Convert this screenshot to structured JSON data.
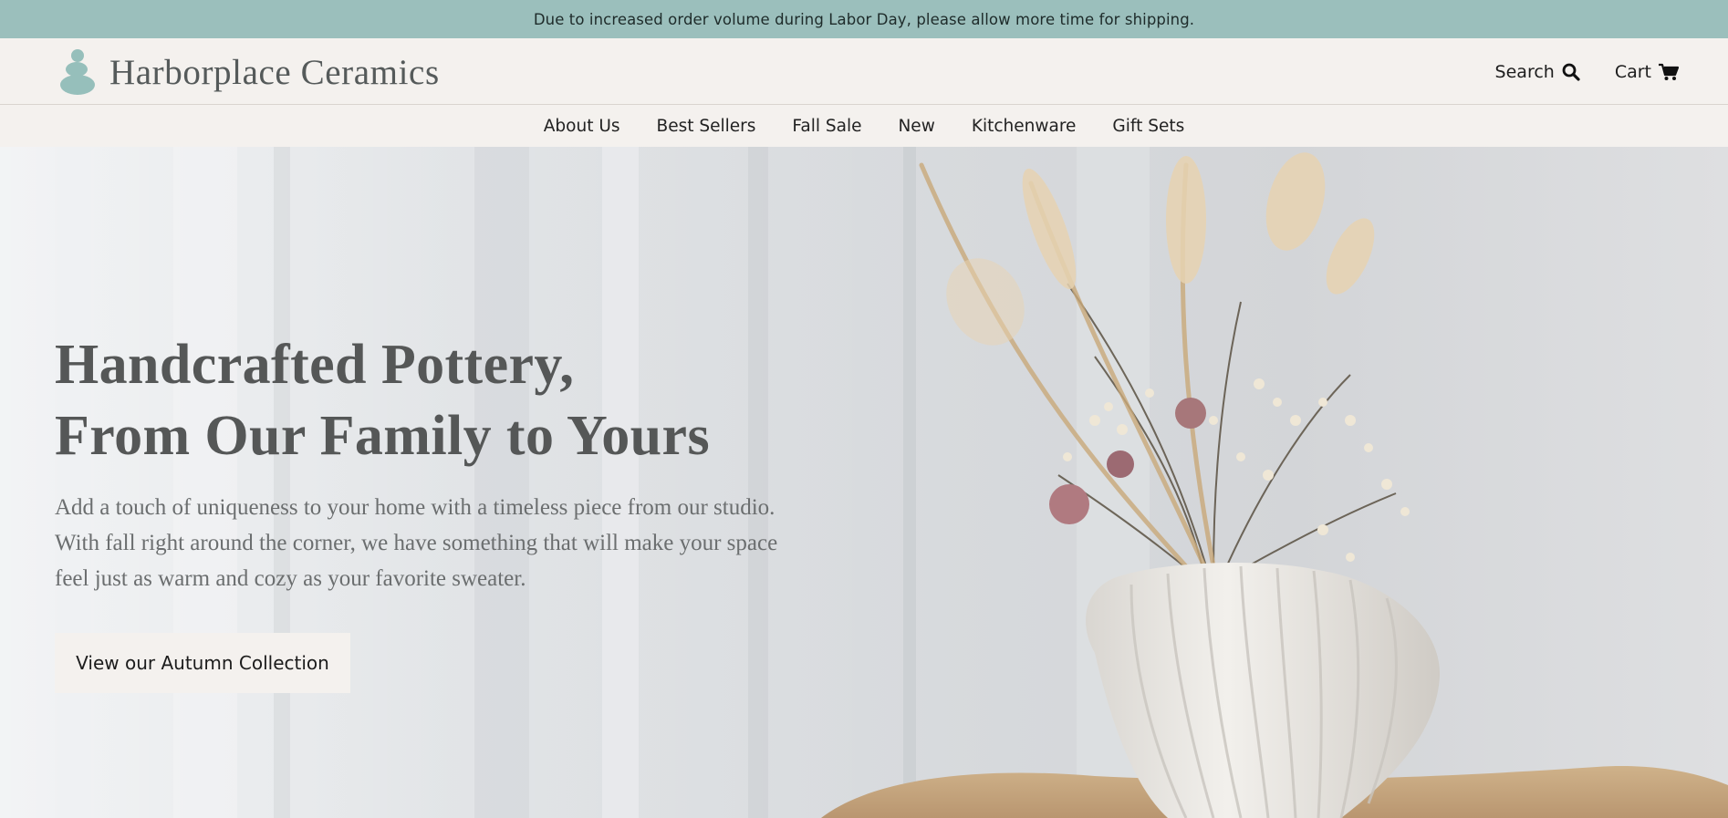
{
  "announcement": "Due to increased order volume during Labor Day, please allow more time for shipping.",
  "brand": {
    "name": "Harborplace Ceramics",
    "logo_icon": "stacked-stones-icon"
  },
  "header": {
    "search_label": "Search",
    "search_icon": "search-icon",
    "cart_label": "Cart",
    "cart_icon": "cart-icon"
  },
  "nav": {
    "items": [
      {
        "label": "About Us"
      },
      {
        "label": "Best Sellers"
      },
      {
        "label": "Fall Sale"
      },
      {
        "label": "New"
      },
      {
        "label": "Kitchenware"
      },
      {
        "label": "Gift Sets"
      }
    ]
  },
  "hero": {
    "title_line1": "Handcrafted Pottery,",
    "title_line2": "From Our Family to Yours",
    "body": "Add a touch of uniqueness to your home with a timeless piece from our studio. With fall right around the corner, we have something that will make your space feel just as warm and cozy as your favorite sweater.",
    "cta_label": "View our Autumn Collection",
    "image_subject": "white shell vase with dried flowers"
  },
  "colors": {
    "announcement_bg": "#9bbfbc",
    "header_bg": "#f4f1ee",
    "logo_mark": "#96bfbb",
    "heading_text": "#555757"
  }
}
